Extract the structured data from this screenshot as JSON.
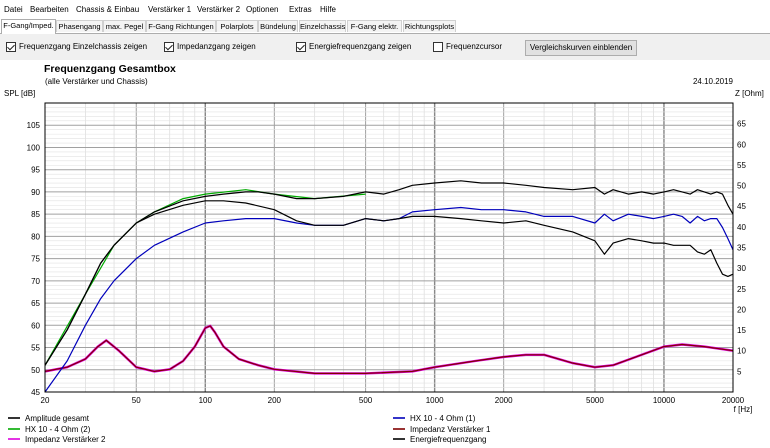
{
  "menu": [
    "Datei",
    "Bearbeiten",
    "Chassis & Einbau",
    "Verstärker 1",
    "Verstärker 2",
    "Optionen",
    "Extras",
    "Hilfe"
  ],
  "tabs": [
    {
      "label": "F-Gang/Imped.",
      "active": true
    },
    {
      "label": "Phasengang",
      "active": false
    },
    {
      "label": "max. Pegel",
      "active": false
    },
    {
      "label": "F-Gang Richtungen",
      "active": false
    },
    {
      "label": "Polarplots",
      "active": false
    },
    {
      "label": "Bündelung",
      "active": false
    },
    {
      "label": "Einzelchassis",
      "active": false
    },
    {
      "label": "F-Gang elektr.",
      "active": false
    },
    {
      "label": "Richtungsplots",
      "active": false
    }
  ],
  "options": {
    "freq_einzelchassis": {
      "label": "Frequenzgang Einzelchassis zeigen",
      "checked": true
    },
    "impedanz": {
      "label": "Impedanzgang zeigen",
      "checked": true
    },
    "energiefreq": {
      "label": "Energiefrequenzgang zeigen",
      "checked": true
    },
    "cursor": {
      "label": "Frequenzcursor",
      "checked": false
    }
  },
  "compare_button": "Vergleichskurven einblenden",
  "chart_data": {
    "type": "line",
    "title": "Frequenzgang Gesamtbox",
    "subtitle": "(alle Verstärker und Chassis)",
    "date": "24.10.2019",
    "ylabel_left": "SPL [dB]",
    "ylabel_right": "Z [Ohm]",
    "xlabel": "f [Hz]",
    "x_scale": "log",
    "xlim": [
      20,
      20000
    ],
    "ylim_left": [
      45,
      110
    ],
    "ylim_right": [
      0,
      70
    ],
    "grid": true,
    "x_tick_labels": [
      "20",
      "50",
      "100",
      "200",
      "500",
      "1000",
      "2000",
      "5000",
      "10000",
      "20000"
    ],
    "y_left_ticks": [
      "45",
      "50",
      "55",
      "60",
      "65",
      "70",
      "75",
      "80",
      "85",
      "90",
      "95",
      "100",
      "105"
    ],
    "y_right_ticks": [
      "5",
      "10",
      "15",
      "20",
      "25",
      "30",
      "35",
      "40",
      "45",
      "50",
      "55",
      "60",
      "65"
    ],
    "series": [
      {
        "name": "Amplitude gesamt",
        "axis": "left",
        "color": "#000000",
        "x": [
          20,
          25,
          30,
          35,
          40,
          50,
          60,
          80,
          100,
          120,
          150,
          200,
          250,
          300,
          400,
          500,
          600,
          700,
          800,
          1000,
          1300,
          1600,
          2000,
          2500,
          3000,
          4000,
          5000,
          5500,
          6000,
          7000,
          8000,
          9000,
          10000,
          11000,
          12000,
          13000,
          14000,
          15000,
          16000,
          17000,
          18000,
          19000,
          20000
        ],
        "y": [
          51,
          59,
          67,
          74,
          78,
          83,
          85,
          87,
          88,
          88,
          87.5,
          86,
          83.5,
          82.5,
          82.5,
          84,
          83.5,
          84,
          84.5,
          84.5,
          84,
          83.5,
          83,
          83.5,
          82.5,
          81,
          79,
          76,
          78.5,
          79.5,
          79,
          78.5,
          78.5,
          78,
          78,
          78,
          76.5,
          76,
          77,
          74,
          71.5,
          71,
          71.5
        ]
      },
      {
        "name": "HX 10 - 4 Ohm (2)",
        "axis": "left",
        "color": "#00aa00",
        "x": [
          20,
          30,
          40,
          50,
          60,
          80,
          100,
          150,
          200,
          300,
          500
        ],
        "y": [
          51,
          67,
          78,
          83,
          85.5,
          88.5,
          89.5,
          90.5,
          89.5,
          88.5,
          89.5
        ]
      },
      {
        "name": "Impedanz Verstärker 2",
        "axis": "right",
        "color": "#dd00dd",
        "x": [
          20,
          25,
          30,
          34,
          37,
          42,
          50,
          60,
          70,
          80,
          90,
          100,
          105,
          110,
          120,
          140,
          170,
          200,
          300,
          500,
          800,
          1000,
          1500,
          2000,
          2500,
          3000,
          4000,
          5000,
          6000,
          8000,
          10000,
          12000,
          15000,
          20000
        ],
        "y": [
          5,
          6,
          8,
          11,
          12.5,
          10,
          6,
          5,
          5.5,
          7.5,
          11,
          15.5,
          16,
          14.5,
          11,
          8,
          6.5,
          5.5,
          4.5,
          4.5,
          5,
          6,
          7.5,
          8.5,
          9,
          9,
          7,
          6,
          6.5,
          9,
          11,
          11.5,
          11,
          10
        ]
      },
      {
        "name": "HX 10 - 4 Ohm (1)",
        "axis": "left",
        "color": "#0000bb",
        "x": [
          20,
          25,
          30,
          35,
          40,
          50,
          60,
          80,
          100,
          120,
          150,
          200,
          250,
          300,
          400,
          500,
          600,
          700,
          800,
          1000,
          1300,
          1600,
          2000,
          2500,
          3000,
          4000,
          5000,
          5500,
          6000,
          7000,
          8000,
          9000,
          10000,
          11000,
          12000,
          13000,
          14000,
          15000,
          16000,
          17000,
          18000,
          19000,
          20000
        ],
        "y": [
          45,
          52,
          60,
          66,
          70,
          75,
          78,
          81,
          83,
          83.5,
          84,
          84,
          83,
          82.5,
          82.5,
          84,
          83.5,
          84,
          85.5,
          86,
          86.5,
          86,
          86,
          85.5,
          84.5,
          84.5,
          83,
          85,
          83.5,
          85,
          84.5,
          84,
          84.5,
          85,
          84.5,
          83,
          84.5,
          83.5,
          84,
          84,
          82,
          79.5,
          77
        ]
      },
      {
        "name": "Impedanz Verstärker 1",
        "axis": "right",
        "color": "#800000",
        "x": [
          20,
          25,
          30,
          34,
          37,
          42,
          50,
          60,
          70,
          80,
          90,
          100,
          105,
          110,
          120,
          140,
          170,
          200,
          300,
          500,
          800,
          1000,
          1500,
          2000,
          2500,
          3000,
          4000,
          5000,
          6000,
          8000,
          10000,
          12000,
          15000,
          20000
        ],
        "y": [
          5,
          6,
          8,
          11,
          12.5,
          10,
          6,
          5,
          5.5,
          7.5,
          11,
          15.5,
          16,
          14.5,
          11,
          8,
          6.5,
          5.5,
          4.5,
          4.5,
          5,
          6,
          7.5,
          8.5,
          9,
          9,
          7,
          6,
          6.5,
          9,
          11,
          11.5,
          11,
          10
        ]
      },
      {
        "name": "Energiefrequenzgang",
        "axis": "left",
        "color": "#000000",
        "x": [
          20,
          25,
          30,
          35,
          40,
          50,
          60,
          80,
          100,
          120,
          150,
          170,
          200,
          250,
          300,
          400,
          500,
          600,
          700,
          800,
          1000,
          1300,
          1600,
          2000,
          2500,
          3000,
          4000,
          5000,
          5500,
          6000,
          7000,
          8000,
          9000,
          10000,
          11000,
          12000,
          13000,
          14000,
          15000,
          16000,
          17000,
          18000,
          19000,
          20000
        ],
        "y": [
          51,
          59,
          67,
          74,
          78,
          83,
          85.5,
          88,
          89,
          89.5,
          90,
          90,
          89.5,
          88.5,
          88.5,
          89,
          90,
          89.5,
          90.5,
          91.5,
          92,
          92.5,
          92,
          92,
          91.5,
          91,
          90.5,
          91,
          89.5,
          90.5,
          89.5,
          90,
          89.5,
          90,
          90.5,
          90,
          89.5,
          90.5,
          90,
          89.5,
          90,
          89.5,
          87,
          85
        ]
      }
    ]
  }
}
